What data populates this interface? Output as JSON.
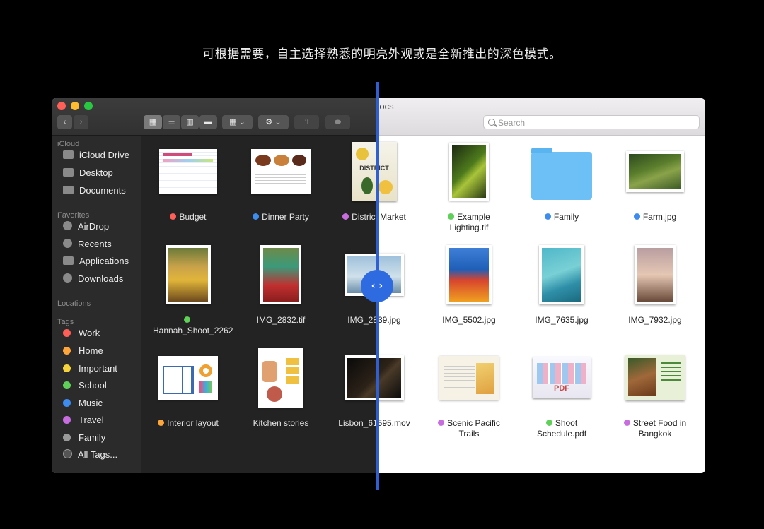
{
  "caption": "可根据需要，自主选择熟悉的明亮外观或是全新推出的深色模式。",
  "window": {
    "title": "Docs",
    "search_placeholder": "Search"
  },
  "toolbar": {
    "back": "‹",
    "forward": "›",
    "view_icon": "▦",
    "list_icon": "☰",
    "column_icon": "▥",
    "gallery_icon": "▬",
    "group_icon": "▦ ⌄",
    "action_icon": "⚙ ⌄",
    "share_icon": "⇧",
    "tag_icon": "⬬"
  },
  "sidebar": {
    "sections": [
      {
        "header": "iCloud",
        "items": [
          {
            "label": "iCloud Drive",
            "icon": "cloud-icon"
          },
          {
            "label": "Desktop",
            "icon": "desktop-icon"
          },
          {
            "label": "Documents",
            "icon": "document-icon"
          }
        ]
      },
      {
        "header": "Favorites",
        "items": [
          {
            "label": "AirDrop",
            "icon": "airdrop-icon"
          },
          {
            "label": "Recents",
            "icon": "recents-icon"
          },
          {
            "label": "Applications",
            "icon": "applications-icon"
          },
          {
            "label": "Downloads",
            "icon": "downloads-icon"
          }
        ]
      },
      {
        "header": "Locations",
        "items": []
      },
      {
        "header": "Tags",
        "items": [
          {
            "label": "Work",
            "color": "#ff5f57"
          },
          {
            "label": "Home",
            "color": "#ffa63a"
          },
          {
            "label": "Important",
            "color": "#f5d33c"
          },
          {
            "label": "School",
            "color": "#5fd058"
          },
          {
            "label": "Music",
            "color": "#3d8cf0"
          },
          {
            "label": "Travel",
            "color": "#c86de0"
          },
          {
            "label": "Family",
            "color": "#9a9a9a"
          },
          {
            "label": "All Tags...",
            "icon": "all-tags-icon"
          }
        ]
      }
    ]
  },
  "files": [
    {
      "name": "Budget",
      "tag": "#ff5f57"
    },
    {
      "name": "Dinner Party",
      "tag": "#3d8cf0"
    },
    {
      "name": "District Market",
      "tag": "#c86de0"
    },
    {
      "name": "Example Lighting.tif",
      "tag": "#5fd058"
    },
    {
      "name": "Family",
      "tag": "#3d8cf0"
    },
    {
      "name": "Farm.jpg",
      "tag": "#3d8cf0"
    },
    {
      "name": "Hannah_Shoot_2262",
      "tag": "#5fd058"
    },
    {
      "name": "IMG_2832.tif",
      "tag": ""
    },
    {
      "name": "IMG_2839.jpg",
      "tag": ""
    },
    {
      "name": "IMG_5502.jpg",
      "tag": ""
    },
    {
      "name": "IMG_7635.jpg",
      "tag": ""
    },
    {
      "name": "IMG_7932.jpg",
      "tag": ""
    },
    {
      "name": "Interior layout",
      "tag": "#ffa63a"
    },
    {
      "name": "Kitchen stories",
      "tag": ""
    },
    {
      "name": "Lisbon_61595.mov",
      "tag": ""
    },
    {
      "name": "Scenic Pacific Trails",
      "tag": "#c86de0"
    },
    {
      "name": "Shoot Schedule.pdf",
      "tag": "#5fd058"
    },
    {
      "name": "Street Food in Bangkok",
      "tag": "#c86de0"
    }
  ],
  "thumb_text": {
    "district": "DISTRICT",
    "pdf": "PDF"
  },
  "slider": {
    "handle": "‹ ›"
  }
}
